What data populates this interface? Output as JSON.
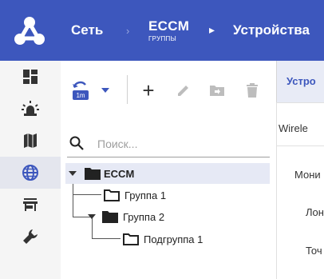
{
  "header": {
    "crumb_network": "Сеть",
    "crumb_eccm_title": "ECCM",
    "crumb_eccm_sub": "ГРУППЫ",
    "crumb_devices": "Устройства",
    "separator": "›",
    "bg_color": "#3d57bd"
  },
  "rail": {
    "items": [
      {
        "name": "dashboard-icon"
      },
      {
        "name": "alarm-icon"
      },
      {
        "name": "map-icon"
      },
      {
        "name": "globe-icon",
        "active": true
      },
      {
        "name": "store-icon"
      },
      {
        "name": "wrench-icon"
      }
    ]
  },
  "toolbar": {
    "refresh_badge": "1m",
    "add": "+",
    "edit_icon": "pencil-icon",
    "move_icon": "folder-move-icon",
    "delete_icon": "trash-icon"
  },
  "search": {
    "placeholder": "Поиск..."
  },
  "tree": {
    "nodes": [
      {
        "label": "ECCM",
        "bold": true,
        "selected": true,
        "expanded": true
      },
      {
        "label": "Группа 1"
      },
      {
        "label": "Группа 2",
        "expanded": true
      },
      {
        "label": "Подгруппа 1"
      }
    ]
  },
  "right": {
    "tab_label": "Устро",
    "row1": "Wirele",
    "row2": "Мони",
    "row3": "Лон",
    "row4": "Точ"
  }
}
